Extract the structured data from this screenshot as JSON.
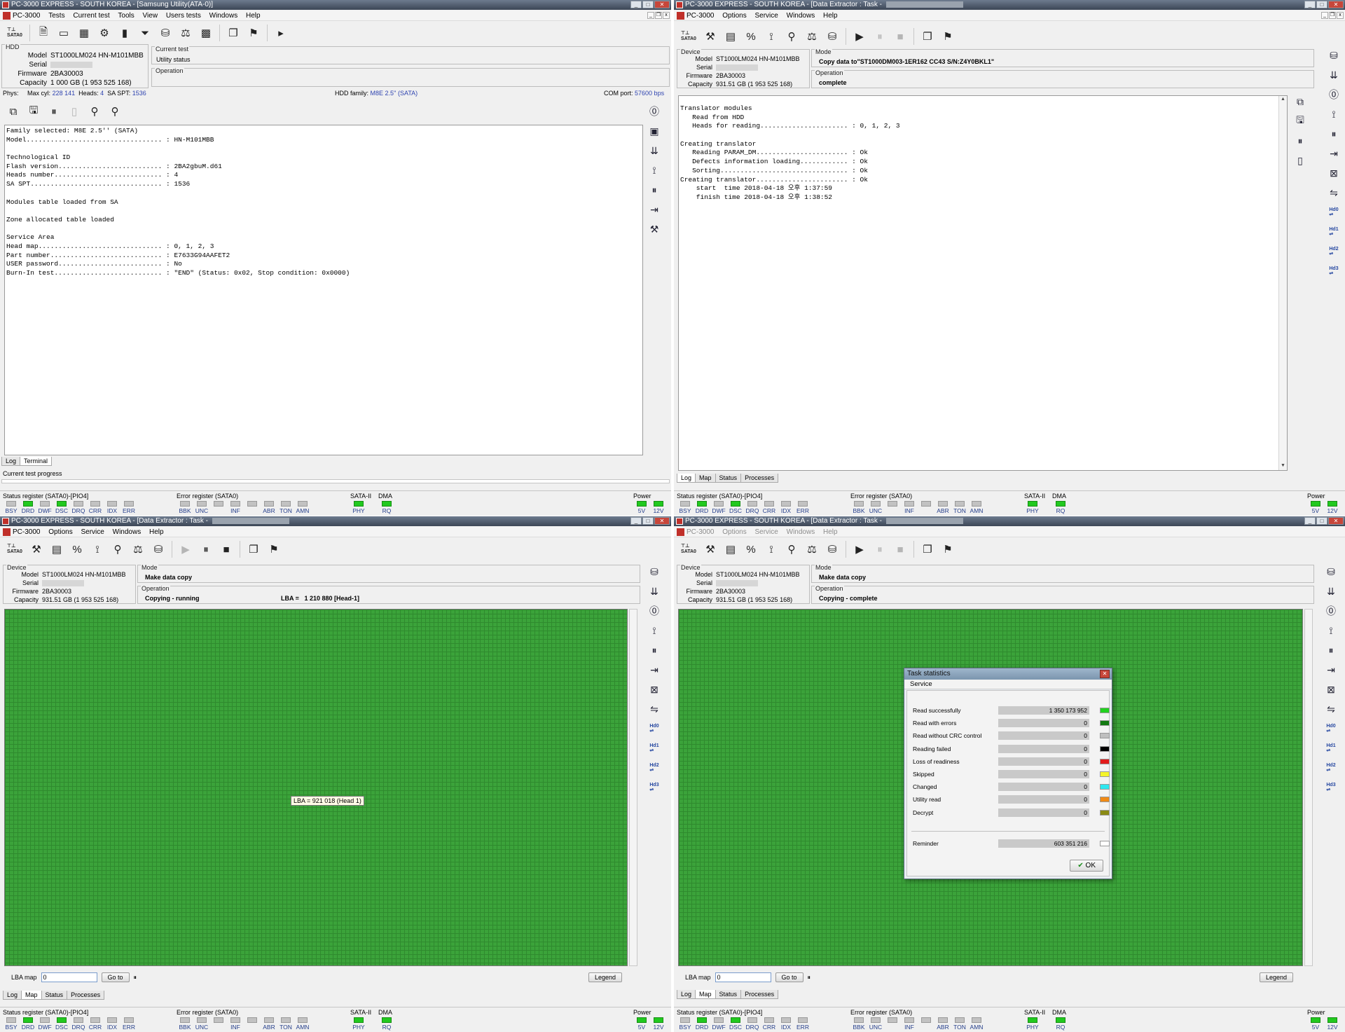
{
  "windows": {
    "tl": {
      "title": "PC-3000 EXPRESS - SOUTH KOREA - [Samsung Utility(ATA-0)]",
      "menu": [
        "PC-3000",
        "Tests",
        "Current test",
        "Tools",
        "View",
        "Users tests",
        "Windows",
        "Help"
      ],
      "hdd_label": "HDD",
      "model_label": "Model",
      "model": "ST1000LM024 HN-M101MBB",
      "serial_label": "Serial",
      "firmware_label": "Firmware",
      "firmware": "2BA30003",
      "capacity_label": "Capacity",
      "capacity": "1 000 GB (1 953 525 168)",
      "current_test_label": "Current test",
      "current_test_value": "Utility status",
      "operation_label": "Operation",
      "phys": {
        "phys_label": "Phys:",
        "max_cyl_label": "Max cyl:",
        "max_cyl": "228 141",
        "heads_label": "Heads:",
        "heads": "4",
        "sa_spt_label": "SA SPT:",
        "sa_spt": "1536",
        "family_label": "HDD family:",
        "family": "M8E 2.5'' (SATA)",
        "com_label": "COM port:",
        "com": "57600 bps"
      },
      "log_lines": [
        "Family selected: M8E 2.5'' (SATA)",
        "Model.................................. : HN-M101MBB",
        "",
        "Technological ID",
        "Flash version.......................... : 2BA2gbuM.d61",
        "Heads number........................... : 4",
        "SA SPT................................. : 1536",
        "",
        "Modules table loaded from SA",
        "",
        "Zone allocated table loaded",
        "",
        "Service Area",
        "Head map............................... : 0, 1, 2, 3",
        "Part number............................ : E7633G94AAFET2",
        "USER password.......................... : No",
        "Burn-In test........................... : \"END\" (Status: 0x02, Stop condition: 0x0000)"
      ],
      "tabs": [
        "Log",
        "Terminal"
      ],
      "progress_label": "Current test progress"
    },
    "tr": {
      "title": "PC-3000 EXPRESS - SOUTH KOREA - [Data Extractor : Task -",
      "menu": [
        "PC-3000",
        "Options",
        "Service",
        "Windows",
        "Help"
      ],
      "device_label": "Device",
      "model_label": "Model",
      "model": "ST1000LM024 HN-M101MBB",
      "serial_label": "Serial",
      "firmware_label": "Firmware",
      "firmware": "2BA30003",
      "capacity_label": "Capacity",
      "capacity": "931.51 GB (1 953 525 168)",
      "mode_label": "Mode",
      "mode_value": "Copy data to\"ST1000DM003-1ER162 CC43 S/N:Z4Y0BKL1\"",
      "operation_label": "Operation",
      "operation_value": "complete",
      "log_lines": [
        "Translator modules",
        "   Read from HDD",
        "   Heads for reading...................... : 0, 1, 2, 3",
        "",
        "Creating translator",
        "   Reading PARAM_DM....................... : Ok",
        "   Defects information loading............ : Ok",
        "   Sorting................................ : Ok",
        "Creating translator....................... : Ok",
        "    start  time 2018-04-18 오후 1:37:59",
        "    finish time 2018-04-18 오후 1:38:52"
      ],
      "tabs": [
        "Log",
        "Map",
        "Status",
        "Processes"
      ]
    },
    "bl": {
      "title": "PC-3000 EXPRESS - SOUTH KOREA - [Data Extractor : Task -",
      "menu": [
        "PC-3000",
        "Options",
        "Service",
        "Windows",
        "Help"
      ],
      "device_label": "Device",
      "model_label": "Model",
      "model": "ST1000LM024 HN-M101MBB",
      "serial_label": "Serial",
      "firmware_label": "Firmware",
      "firmware": "2BA30003",
      "capacity_label": "Capacity",
      "capacity": "931.51 GB (1 953 525 168)",
      "mode_label": "Mode",
      "mode_value": "Make data copy",
      "operation_label": "Operation",
      "operation_value": "Copying - running",
      "lba_label": "LBA =",
      "lba_value": "1 210 880  [Head-1]",
      "tooltip": "LBA =   921 018 (Head 1)",
      "lba_map_label": "LBA map",
      "lba_map_value": "0",
      "goto": "Go to",
      "legend": "Legend",
      "tabs": [
        "Log",
        "Map",
        "Status",
        "Processes"
      ]
    },
    "br": {
      "title": "PC-3000 EXPRESS - SOUTH KOREA - [Data Extractor : Task -",
      "menu": [
        "PC-3000",
        "Options",
        "Service",
        "Windows",
        "Help"
      ],
      "device_label": "Device",
      "model_label": "Model",
      "model": "ST1000LM024 HN-M101MBB",
      "serial_label": "Serial",
      "firmware_label": "Firmware",
      "firmware": "2BA30003",
      "capacity_label": "Capacity",
      "capacity": "931.51 GB (1 953 525 168)",
      "mode_label": "Mode",
      "mode_value": "Make data copy",
      "operation_label": "Operation",
      "operation_value": "Copying - complete",
      "lba_map_label": "LBA map",
      "lba_map_value": "0",
      "goto": "Go to",
      "legend": "Legend",
      "tabs": [
        "Log",
        "Map",
        "Status",
        "Processes"
      ]
    }
  },
  "registers": {
    "status_title": "Status register (SATA0)-[PIO4]",
    "status_leds": [
      {
        "label": "BSY",
        "on": false
      },
      {
        "label": "DRD",
        "on": true
      },
      {
        "label": "DWF",
        "on": false
      },
      {
        "label": "DSC",
        "on": true
      },
      {
        "label": "DRQ",
        "on": false
      },
      {
        "label": "CRR",
        "on": false
      },
      {
        "label": "IDX",
        "on": false
      },
      {
        "label": "ERR",
        "on": false
      }
    ],
    "error_title": "Error register (SATA0)",
    "error_leds": [
      "BBK",
      "UNC",
      "",
      "INF",
      "",
      "ABR",
      "TON",
      "AMN"
    ],
    "sata_title": "SATA-II",
    "sata_led": "PHY",
    "dma_title": "DMA",
    "dma_led": "RQ",
    "power_title": "Power",
    "power_leds": [
      "5V",
      "12V"
    ]
  },
  "dialog": {
    "title": "Task statistics",
    "menu": "Service",
    "rows": [
      {
        "label": "Read successfully",
        "value": "1 350 173 952",
        "color": "#22d11f"
      },
      {
        "label": "Read with errors",
        "value": "0",
        "color": "#137a12"
      },
      {
        "label": "Read without CRC control",
        "value": "0",
        "color": "#bfbfbf"
      },
      {
        "label": "Reading failed",
        "value": "0",
        "color": "#000000"
      },
      {
        "label": "Loss of readiness",
        "value": "0",
        "color": "#e21b1b"
      },
      {
        "label": "Skipped",
        "value": "0",
        "color": "#f5f52a"
      },
      {
        "label": "Changed",
        "value": "0",
        "color": "#2ee8f0"
      },
      {
        "label": "Utility read",
        "value": "0",
        "color": "#f08a16"
      },
      {
        "label": "Decrypt",
        "value": "0",
        "color": "#8a8a15"
      }
    ],
    "reminder_label": "Reminder",
    "reminder_value": "603 351 216",
    "ok": "OK"
  }
}
